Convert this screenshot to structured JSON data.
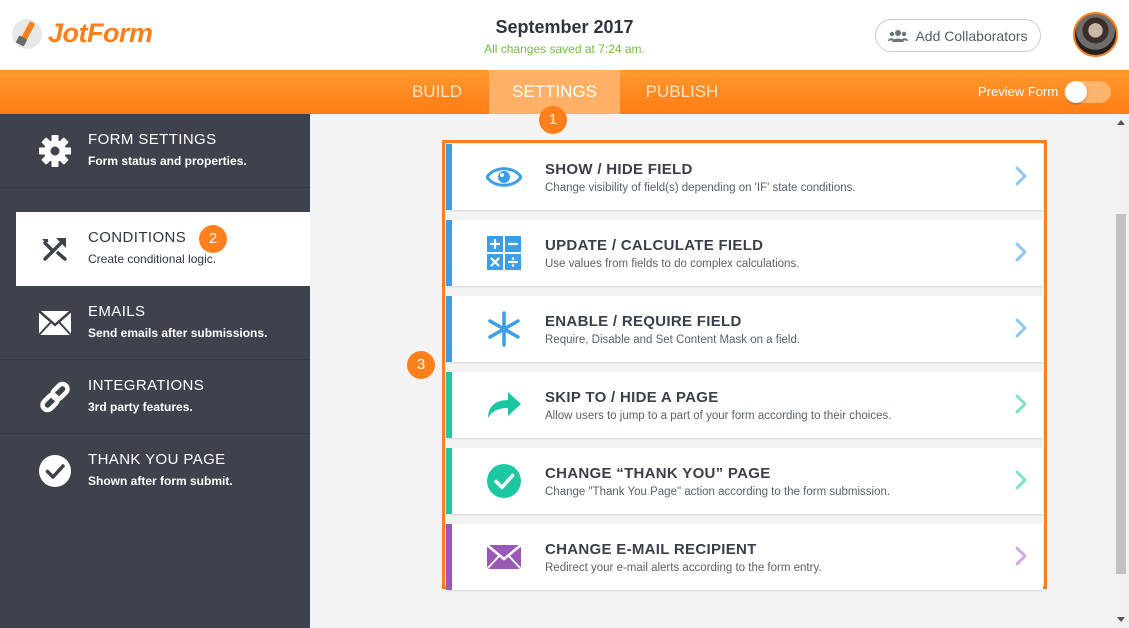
{
  "header": {
    "logo_text": "JotForm",
    "form_title": "September 2017",
    "save_status": "All changes saved at 7:24 am.",
    "collab_label": "Add Collaborators"
  },
  "nav": {
    "tabs": [
      {
        "label": "BUILD",
        "active": false
      },
      {
        "label": "SETTINGS",
        "active": true
      },
      {
        "label": "PUBLISH",
        "active": false
      }
    ],
    "preview_label": "Preview Form",
    "preview_enabled": false
  },
  "sidebar": {
    "items": [
      {
        "title": "FORM SETTINGS",
        "subtitle": "Form status and properties.",
        "icon": "gear-icon",
        "active": false
      },
      {
        "title": "CONDITIONS",
        "subtitle": "Create conditional logic.",
        "icon": "conditions-icon",
        "active": true
      },
      {
        "title": "EMAILS",
        "subtitle": "Send emails after submissions.",
        "icon": "envelope-icon",
        "active": false
      },
      {
        "title": "INTEGRATIONS",
        "subtitle": "3rd party features.",
        "icon": "link-icon",
        "active": false
      },
      {
        "title": "THANK YOU PAGE",
        "subtitle": "Shown after form submit.",
        "icon": "check-circle-icon",
        "active": false
      }
    ]
  },
  "badges": {
    "one": "1",
    "two": "2",
    "three": "3"
  },
  "conditions": [
    {
      "title": "SHOW / HIDE FIELD",
      "desc": "Change visibility of field(s) depending on 'IF' state conditions.",
      "icon": "eye-icon",
      "color": "#3c9ee5"
    },
    {
      "title": "UPDATE / CALCULATE FIELD",
      "desc": "Use values from fields to do complex calculations.",
      "icon": "calculator-icon",
      "color": "#3c9ee5"
    },
    {
      "title": "ENABLE / REQUIRE FIELD",
      "desc": "Require, Disable and Set Content Mask on a field.",
      "icon": "asterisk-icon",
      "color": "#3c9ee5"
    },
    {
      "title": "SKIP TO / HIDE A PAGE",
      "desc": "Allow users to jump to a part of your form according to their choices.",
      "icon": "share-arrow-icon",
      "color": "#1dc7a2"
    },
    {
      "title": "CHANGE “THANK YOU” PAGE",
      "desc": "Change \"Thank You Page\" action according to the form submission.",
      "icon": "check-circle-icon",
      "color": "#1dc7a2"
    },
    {
      "title": "CHANGE E-MAIL RECIPIENT",
      "desc": "Redirect your e-mail alerts according to the form entry.",
      "icon": "envelope-icon",
      "color": "#9b59b6"
    }
  ],
  "colors": {
    "brand": "#ff7f1c",
    "sidebar_bg": "#3d424d",
    "blue": "#3c9ee5",
    "teal": "#1dc7a2",
    "purple": "#9b59b6"
  }
}
